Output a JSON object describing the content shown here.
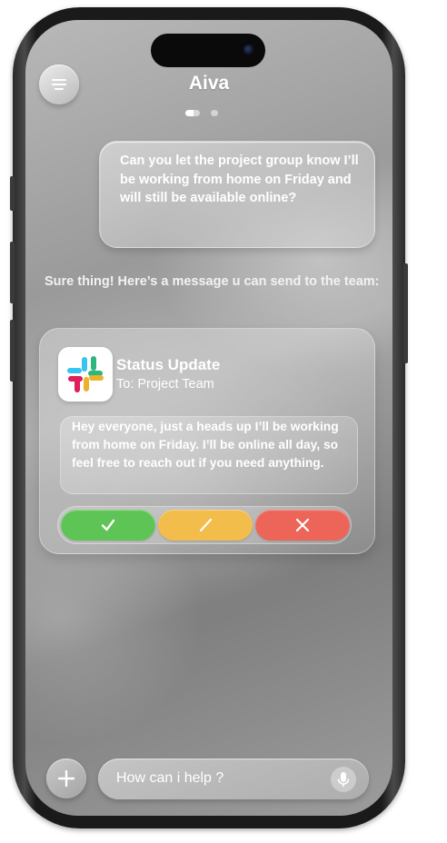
{
  "app": {
    "title": "Aiva"
  },
  "page_indicator": {
    "current": 1,
    "total": 2
  },
  "chat": {
    "user_message": "Can you let the project group know I’ll be working from home on Friday and will still be available online?",
    "assistant_message": "Sure thing! Here’s a message u can send to the team:"
  },
  "card": {
    "app_icon": "slack-icon",
    "title": "Status Update",
    "recipient": "To: Project Team",
    "message": "Hey everyone, just a heads up I’ll be working from home on Friday. I’ll be online all day, so feel free to reach out if you need anything.",
    "actions": [
      {
        "name": "approve",
        "icon": "check-icon",
        "color": "#5ec455"
      },
      {
        "name": "edit",
        "icon": "pencil-icon",
        "color": "#f2bd4a"
      },
      {
        "name": "reject",
        "icon": "close-icon",
        "color": "#ec6558"
      }
    ]
  },
  "composer": {
    "placeholder": "How can i help ?",
    "add_icon": "plus-icon",
    "mic_icon": "microphone-icon"
  },
  "colors": {
    "slack_blue": "#36C5F0",
    "slack_green": "#2EB67D",
    "slack_yellow": "#ECB22E",
    "slack_red": "#E01E5A"
  }
}
